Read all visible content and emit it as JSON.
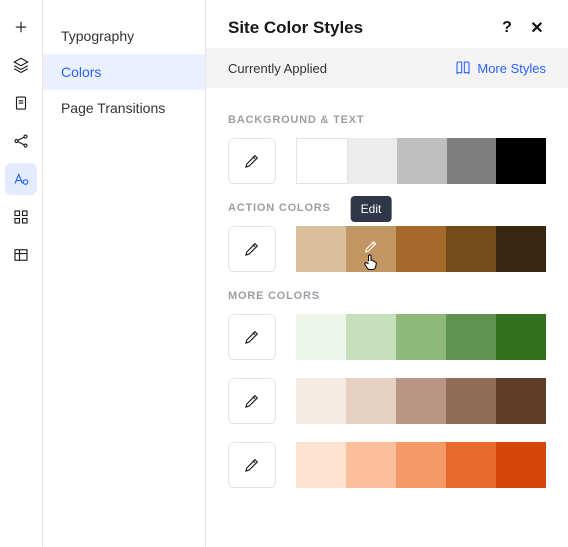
{
  "iconRail": {
    "items": [
      {
        "name": "add-icon"
      },
      {
        "name": "layers-icon"
      },
      {
        "name": "page-icon"
      },
      {
        "name": "share-icon"
      },
      {
        "name": "text-style-icon",
        "active": true
      },
      {
        "name": "grid-icon"
      },
      {
        "name": "table-icon"
      }
    ]
  },
  "subnav": {
    "items": [
      {
        "label": "Typography"
      },
      {
        "label": "Colors",
        "active": true
      },
      {
        "label": "Page Transitions"
      }
    ]
  },
  "header": {
    "title": "Site Color Styles",
    "help_label": "?",
    "close_label": "✕"
  },
  "appliedBar": {
    "label": "Currently Applied",
    "more_label": "More Styles"
  },
  "tooltip": {
    "edit_label": "Edit"
  },
  "sections": {
    "bgtext": {
      "label": "BACKGROUND & TEXT",
      "colors": [
        "#ffffff",
        "#edecec",
        "#bfbfbf",
        "#7e7e7e",
        "#000000"
      ]
    },
    "action": {
      "label": "ACTION COLORS",
      "colors": [
        "#d9bf9b",
        "#c29662",
        "#a5692b",
        "#744b1b",
        "#3a2712"
      ],
      "hover_index": 1
    },
    "more": {
      "label": "MORE COLORS",
      "rows": [
        [
          "#eef6eb",
          "#c6e0bb",
          "#8fb97a",
          "#5f9350",
          "#33711f"
        ],
        [
          "#f4eae2",
          "#e6d0c1",
          "#b99684",
          "#8f6c56",
          "#5f3e29"
        ],
        [
          "#fde2d0",
          "#fbbf9b",
          "#f39a66",
          "#e76a2a",
          "#d44708"
        ]
      ]
    }
  }
}
